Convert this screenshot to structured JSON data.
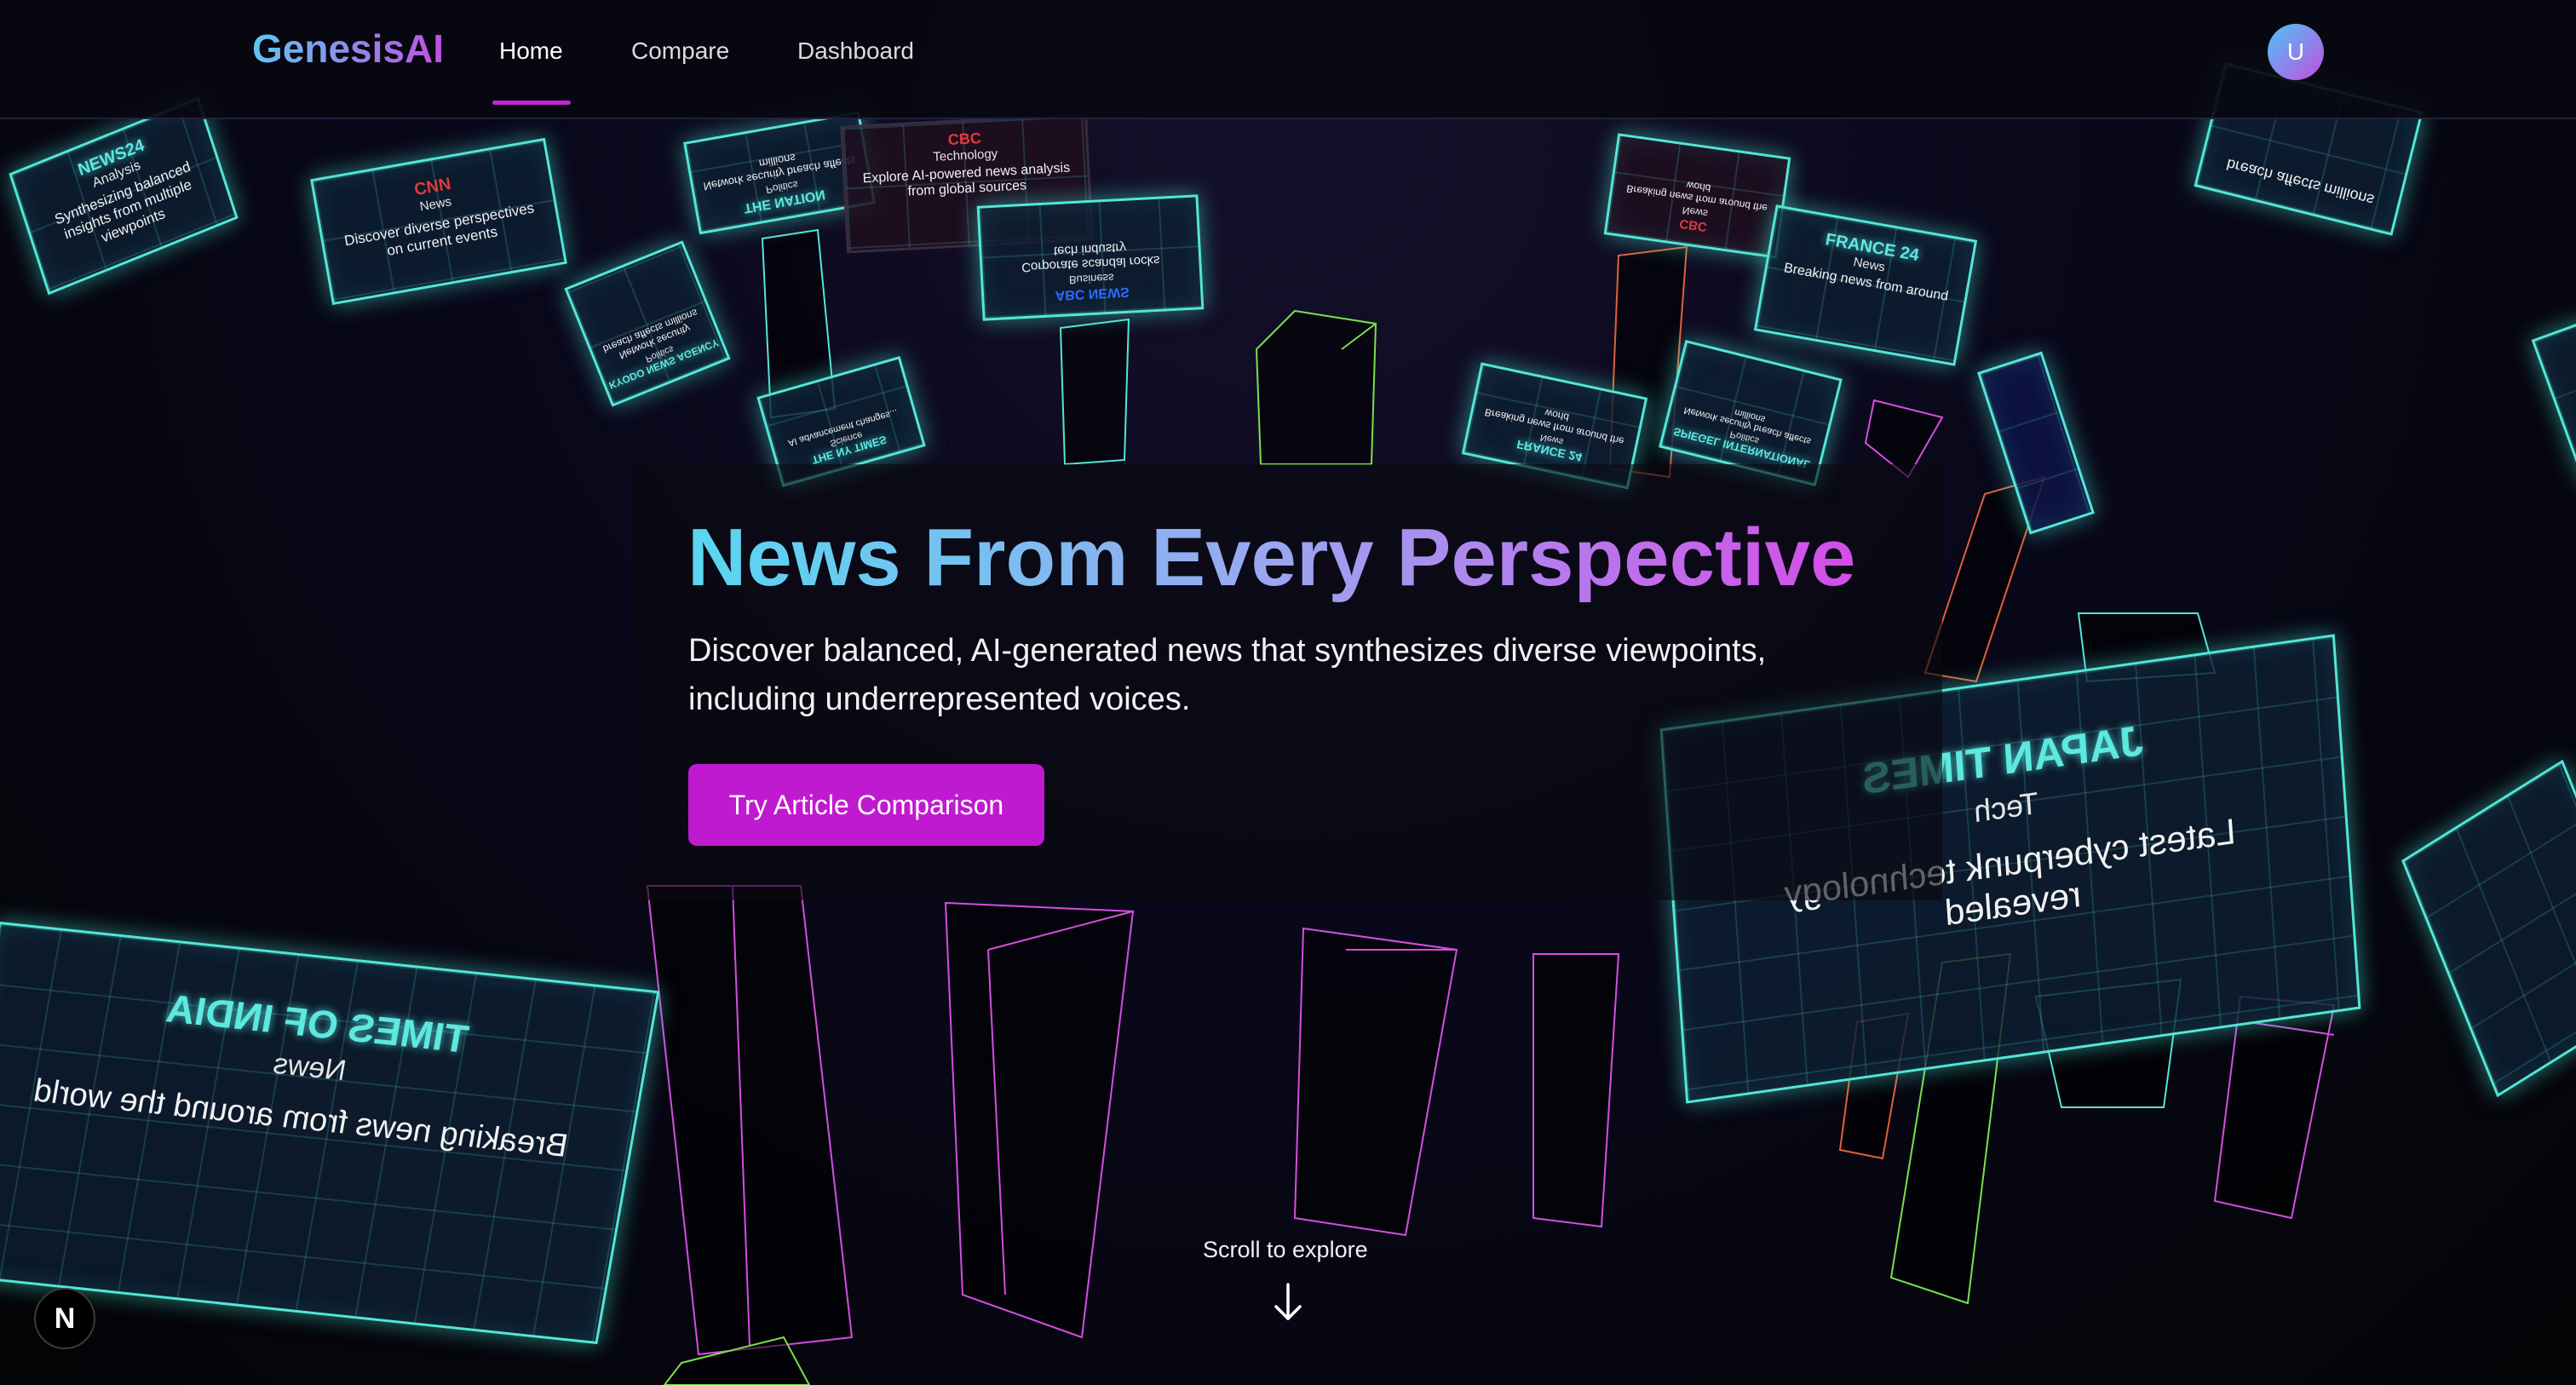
{
  "nav": {
    "logo": "GenesisAI",
    "links": [
      "Home",
      "Compare",
      "Dashboard"
    ],
    "active": "Home",
    "avatar_initial": "U"
  },
  "hero": {
    "title": "News From Every Perspective",
    "subtitle": "Discover balanced, AI-generated news that synthesizes diverse viewpoints, including underrepresented voices.",
    "cta": "Try Article Comparison"
  },
  "scroll": {
    "label": "Scroll to explore"
  },
  "dev_badge": "N",
  "cards": [
    {
      "source": "NEWS24",
      "category": "Analysis",
      "headline": "Synthesizing balanced insights from multiple viewpoints"
    },
    {
      "source": "CNN",
      "category": "News",
      "headline": "Discover diverse perspectives on current events"
    },
    {
      "source": "THE NATION",
      "category": "Politics",
      "headline": "Network security breach affects millions"
    },
    {
      "source": "CBC",
      "category": "Technology",
      "headline": "Explore AI-powered news analysis from global sources"
    },
    {
      "source": "ABC NEWS",
      "category": "Business",
      "headline": "Corporate scandal rocks tech industry"
    },
    {
      "source": "CBC",
      "category": "News",
      "headline": "Breaking news from around the world"
    },
    {
      "source": "FRANCE 24",
      "category": "News",
      "headline": "Breaking news from around"
    },
    {
      "source": "FRANCE 24",
      "category": "News",
      "headline": "Breaking news from around the world"
    },
    {
      "source": "SPIEGEL INTERNATIONAL",
      "category": "Politics",
      "headline": "Network security breach affects millions"
    },
    {
      "source": "KYODO NEWS AGENCY",
      "category": "Politics",
      "headline": "Network security breach affects millions"
    },
    {
      "source": "THE NY TIMES",
      "category": "Science",
      "headline": "AI advancement changes..."
    },
    {
      "source": "TIMES OF INDIA",
      "category": "News",
      "headline": "Breaking news from around the world"
    },
    {
      "source": "JAPAN TIMES",
      "category": "Tech",
      "headline": "Latest cyberpunk technology revealed"
    },
    {
      "source": "",
      "category": "",
      "headline": "breach affects millions"
    }
  ],
  "colors": {
    "accent": "#c026d3",
    "cyan_glow": "#53e6d7",
    "pillar_magenta": "#d44ee0",
    "pillar_green": "#7be04c",
    "pillar_orange": "#e0603a"
  }
}
